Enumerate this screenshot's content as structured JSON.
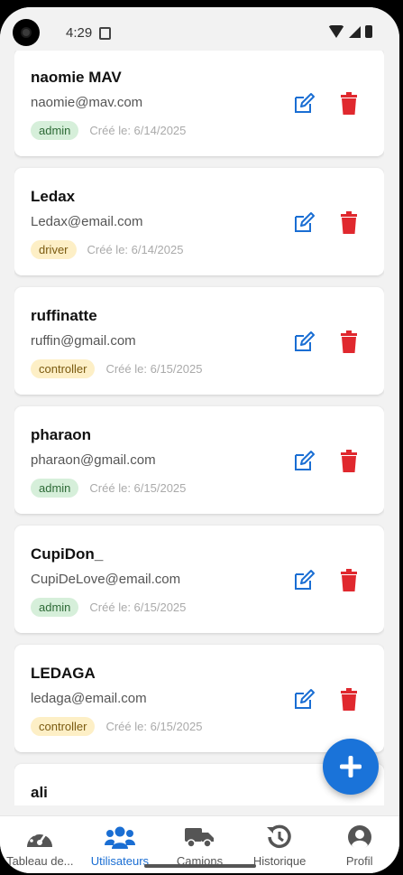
{
  "status_bar": {
    "time": "4:29"
  },
  "users": [
    {
      "name": "naomie MAV",
      "email": "naomie@mav.com",
      "role": "admin",
      "created": "Créé le: 6/14/2025"
    },
    {
      "name": "Ledax",
      "email": "Ledax@email.com",
      "role": "driver",
      "created": "Créé le: 6/14/2025"
    },
    {
      "name": "ruffinatte",
      "email": "ruffin@gmail.com",
      "role": "controller",
      "created": "Créé le: 6/15/2025"
    },
    {
      "name": "pharaon",
      "email": "pharaon@gmail.com",
      "role": "admin",
      "created": "Créé le: 6/15/2025"
    },
    {
      "name": "CupiDon_",
      "email": "CupiDeLove@email.com",
      "role": "admin",
      "created": "Créé le: 6/15/2025"
    },
    {
      "name": "LEDAGA",
      "email": "ledaga@email.com",
      "role": "controller",
      "created": "Créé le: 6/15/2025"
    },
    {
      "name": "ali",
      "email": "",
      "role": "",
      "created": ""
    }
  ],
  "colors": {
    "accent": "#1a73d9",
    "edit_icon": "#1a6ed3",
    "delete_icon": "#e0282e",
    "nav_inactive": "#555555"
  },
  "fab": {
    "icon": "plus-icon"
  },
  "bottom_nav": {
    "items": [
      {
        "label": "Tableau de...",
        "icon": "dashboard-icon",
        "active": false
      },
      {
        "label": "Utilisateurs",
        "icon": "users-icon",
        "active": true
      },
      {
        "label": "Camions",
        "icon": "truck-icon",
        "active": false
      },
      {
        "label": "Historique",
        "icon": "history-icon",
        "active": false
      },
      {
        "label": "Profil",
        "icon": "profile-icon",
        "active": false
      }
    ]
  }
}
